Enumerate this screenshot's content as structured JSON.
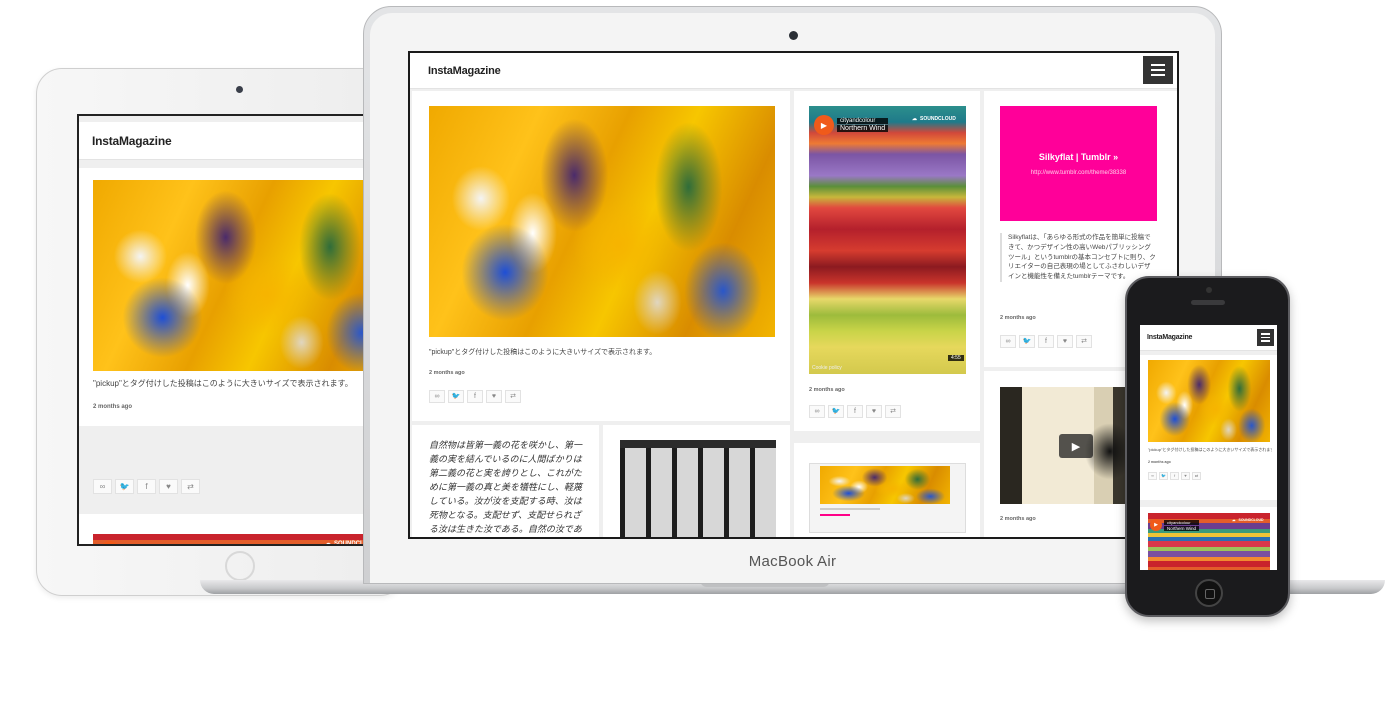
{
  "site": {
    "title": "InstaMagazine",
    "pickup_caption": "\"pickup\"とタグ付けした投稿はこのように大きいサイズで表示されます。",
    "date": "2 months ago"
  },
  "soundcloud": {
    "artist": "cityandcolour",
    "track": "Northern Wind",
    "brand": "SOUNDCLOUD",
    "duration": "4:55",
    "cookie": "Cookie policy"
  },
  "tumblr_card": {
    "title": "Silkyflat | Tumblr »",
    "url": "http://www.tumblr.com/theme/38338",
    "description": "Silkyflatは、「あらゆる形式の作品を簡単に投稿できて、かつデザイン性の高いWebパブリッシングツール」というtumblrの基本コンセプトに則り、クリエイターの自己表現の場としてふさわしいデザインと機能性を備えたtumblrテーマです。"
  },
  "quote": {
    "text": "自然物は皆第一義の花を咲かし、第一義の実を結んでいるのに人間ばかりは第二義の花と実を誇りとし、これがために第一義の真と美を犠牲にし、軽蔑している。汝が汝を支配する時、汝は死物となる。支配せず、支配せられざる汝は生きた汝である。自然の汝である。"
  },
  "device": {
    "laptop_brand": "MacBook Air"
  },
  "actions": [
    {
      "icon": "link-icon",
      "glyph": "∞"
    },
    {
      "icon": "twitter-icon",
      "glyph": "🐦"
    },
    {
      "icon": "facebook-icon",
      "glyph": "f"
    },
    {
      "icon": "like-icon",
      "glyph": "♥"
    },
    {
      "icon": "reblog-icon",
      "glyph": "⇄"
    }
  ],
  "colors": {
    "tumblr_pink": "#ff0099",
    "soundcloud_orange": "#f05a1a",
    "menu_dark": "#333333"
  }
}
